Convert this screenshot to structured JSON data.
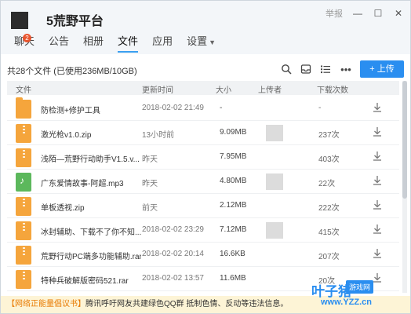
{
  "window": {
    "title": "5荒野平台",
    "report_label": "举报",
    "min_glyph": "—",
    "max_glyph": "☐",
    "close_glyph": "✕"
  },
  "tabs": [
    {
      "label": "聊天",
      "badge": "2"
    },
    {
      "label": "公告"
    },
    {
      "label": "相册"
    },
    {
      "label": "文件"
    },
    {
      "label": "应用"
    },
    {
      "label": "设置"
    }
  ],
  "toolbar": {
    "file_count": "共28个文件 (已使用236MB/10GB)",
    "upload_label": "+ 上传",
    "icons": [
      "search-icon",
      "inbox-icon",
      "list-view-icon",
      "more-icon"
    ]
  },
  "table": {
    "columns": [
      "文件",
      "更新时间",
      "大小",
      "上传者",
      "下载次数"
    ],
    "rows": [
      {
        "icon": "folder",
        "name": "防检测+修护工具",
        "time": "2018-02-02 21:49",
        "size": "-",
        "downloads": "-"
      },
      {
        "icon": "zip",
        "name": "激光枪v1.0.zip",
        "time": "13小时前",
        "size": "9.09MB",
        "downloads": "237次"
      },
      {
        "icon": "zip",
        "name": "浅陌—荒野行动助手V1.5.v...",
        "time": "昨天",
        "size": "7.95MB",
        "downloads": "403次"
      },
      {
        "icon": "mp3",
        "name": "广东爱情故事-阿超.mp3",
        "time": "昨天",
        "size": "4.80MB",
        "downloads": "22次"
      },
      {
        "icon": "zip",
        "name": "单板透视.zip",
        "time": "前天",
        "size": "2.12MB",
        "downloads": "222次"
      },
      {
        "icon": "zip",
        "name": "冰封辅助、下载不了你不知...",
        "time": "2018-02-02 23:29",
        "size": "7.12MB",
        "downloads": "415次"
      },
      {
        "icon": "zip",
        "name": "荒野行动PC端多功能辅助.rar",
        "time": "2018-02-02 20:14",
        "size": "16.6KB",
        "downloads": "207次"
      },
      {
        "icon": "zip",
        "name": "特种兵破解版密码521.rar",
        "time": "2018-02-02 13:57",
        "size": "11.6MB",
        "downloads": "20次"
      }
    ]
  },
  "notice": {
    "prefix": "【网络正能量倡议书】",
    "text": "腾讯呼吁网友共建绿色QQ群 抵制色情、反动等违法信息。"
  },
  "watermark": {
    "main": "叶子猪",
    "tag": "游戏网",
    "url": "www.YZZ.cn"
  },
  "colors": {
    "accent": "#2a8ef0",
    "folder": "#f5a53c",
    "audio": "#5cb85c",
    "badge": "#e8552f"
  }
}
